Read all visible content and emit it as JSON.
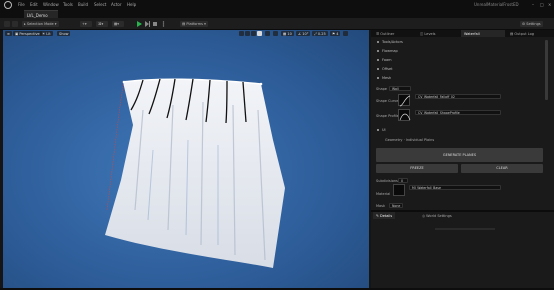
{
  "menu": [
    "File",
    "Edit",
    "Window",
    "Tools",
    "Build",
    "Select",
    "Actor",
    "Help"
  ],
  "title_right": "UnrealMaterialFrostED",
  "level_tab": "LVL_Demo",
  "toolbar": {
    "mode": "Selection Mode",
    "platforms": "Platforms",
    "settings": "Settings"
  },
  "viewport": {
    "view_label": "Perspective",
    "lit_label": "Lit",
    "show_label": "Show",
    "speed": "0.25",
    "grid": "10"
  },
  "right_tabs": [
    "Outliner",
    "Levels",
    "Waterfall",
    "Output Log"
  ],
  "sections": [
    "Tools/Actors",
    "Flowmap",
    "Foam",
    "Offset",
    "Mesh"
  ],
  "shape": {
    "label": "Shape",
    "value": "Wall",
    "curve_label": "Shape Curve",
    "curve_value": "CV_Waterfall_Falloff_02",
    "profile_label": "Shape Profile",
    "profile_value": "CV_Waterfall_ShapeProfile"
  },
  "ui_section": "UI",
  "geometry_label": "Geometry · Individual Plains",
  "generate_button": "GENERATE PLANES",
  "freeze_button": "FREEZE",
  "clear_button": "CLEAR",
  "subdivisions": {
    "label": "Subdivisions",
    "value": "0"
  },
  "material": {
    "label": "Material",
    "value": "MI_Waterfall_Base"
  },
  "mask": {
    "label": "Mask",
    "value": "None"
  },
  "details_tabs": [
    "Details",
    "World Settings"
  ],
  "colors": {
    "sky": "#2d5c98",
    "panel": "#1a1a1a",
    "accent": "#29b34d"
  }
}
